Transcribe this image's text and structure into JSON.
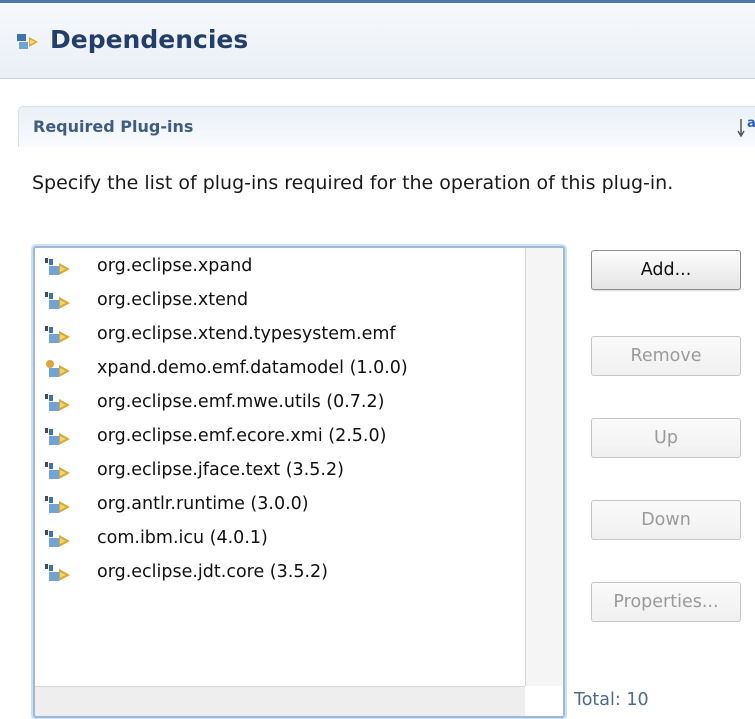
{
  "header": {
    "title": "Dependencies",
    "icon": "plugin-dependencies-icon"
  },
  "section": {
    "title": "Required Plug-ins",
    "sort_icon": "sort-alphabetical-icon"
  },
  "description": "Specify the list of plug-ins required for the operation of this plug-in.",
  "plugins": [
    {
      "label": "org.eclipse.xpand",
      "icon": "plugin-icon"
    },
    {
      "label": "org.eclipse.xtend",
      "icon": "plugin-icon"
    },
    {
      "label": "org.eclipse.xtend.typesystem.emf",
      "icon": "plugin-icon"
    },
    {
      "label": "xpand.demo.emf.datamodel (1.0.0)",
      "icon": "workspace-plugin-icon"
    },
    {
      "label": "org.eclipse.emf.mwe.utils (0.7.2)",
      "icon": "plugin-icon"
    },
    {
      "label": "org.eclipse.emf.ecore.xmi (2.5.0)",
      "icon": "plugin-icon"
    },
    {
      "label": "org.eclipse.jface.text (3.5.2)",
      "icon": "plugin-icon"
    },
    {
      "label": "org.antlr.runtime (3.0.0)",
      "icon": "plugin-icon"
    },
    {
      "label": "com.ibm.icu (4.0.1)",
      "icon": "plugin-icon"
    },
    {
      "label": "org.eclipse.jdt.core (3.5.2)",
      "icon": "plugin-icon"
    }
  ],
  "buttons": {
    "add": "Add...",
    "remove": "Remove",
    "up": "Up",
    "down": "Down",
    "properties": "Properties..."
  },
  "total_label": "Total: 10",
  "colors": {
    "title": "#243e6b",
    "section": "#3f5c82",
    "accent": "#4d79b0"
  }
}
